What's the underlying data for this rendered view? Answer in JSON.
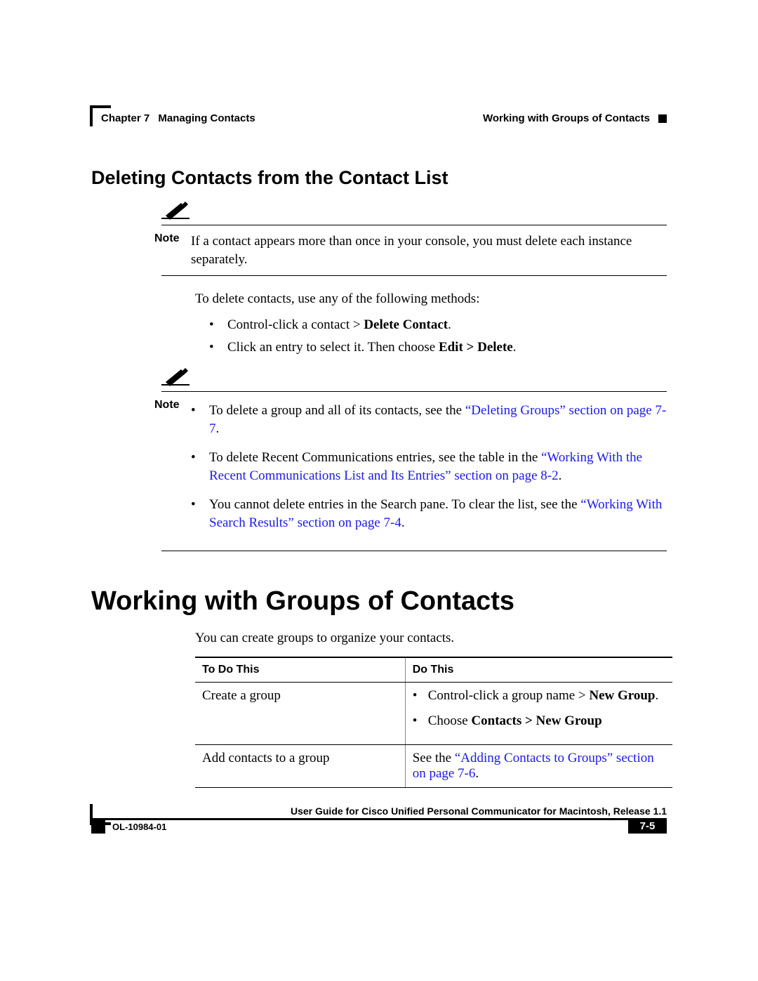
{
  "header": {
    "chapter_label": "Chapter 7",
    "chapter_title": "Managing Contacts",
    "section_right": "Working with Groups of Contacts"
  },
  "section1": {
    "heading": "Deleting Contacts from the Contact List",
    "note_label": "Note",
    "note_text": "If a contact appears more than once in your console, you must delete each instance separately.",
    "intro": "To delete contacts, use any of the following methods:",
    "bullets": [
      {
        "pre": "Control-click a contact > ",
        "bold": "Delete Contact",
        "post": "."
      },
      {
        "pre": "Click an entry to select it. Then choose ",
        "bold": "Edit > Delete",
        "post": "."
      }
    ]
  },
  "note2": {
    "label": "Note",
    "items": [
      {
        "pre": "To delete a group and all of its contacts, see the ",
        "link": "“Deleting Groups” section on page 7-7",
        "post": "."
      },
      {
        "pre": "To delete Recent Communications entries, see the table in the ",
        "link": "“Working With the Recent Communications List and Its Entries” section on page 8-2",
        "post": "."
      },
      {
        "pre": "You cannot delete entries in the Search pane. To clear the list, see the ",
        "link": "“Working With Search Results” section on page 7-4",
        "post": "."
      }
    ]
  },
  "section2": {
    "heading": "Working with Groups of Contacts",
    "intro": "You can create groups to organize your contacts.",
    "table": {
      "col1": "To Do This",
      "col2": "Do This",
      "rows": [
        {
          "left": "Create a group",
          "right_items": [
            {
              "pre": "Control-click a group name > ",
              "bold": "New Group",
              "post": "."
            },
            {
              "pre": "Choose ",
              "bold": "Contacts > New Group",
              "post": ""
            }
          ]
        },
        {
          "left": "Add contacts to a group",
          "right_plain_pre": "See the ",
          "right_link": "“Adding Contacts to Groups” section on page 7-6",
          "right_plain_post": "."
        }
      ]
    }
  },
  "footer": {
    "book_title": "User Guide for Cisco Unified Personal Communicator for Macintosh, Release 1.1",
    "doc_id": "OL-10984-01",
    "page_num": "7-5"
  }
}
